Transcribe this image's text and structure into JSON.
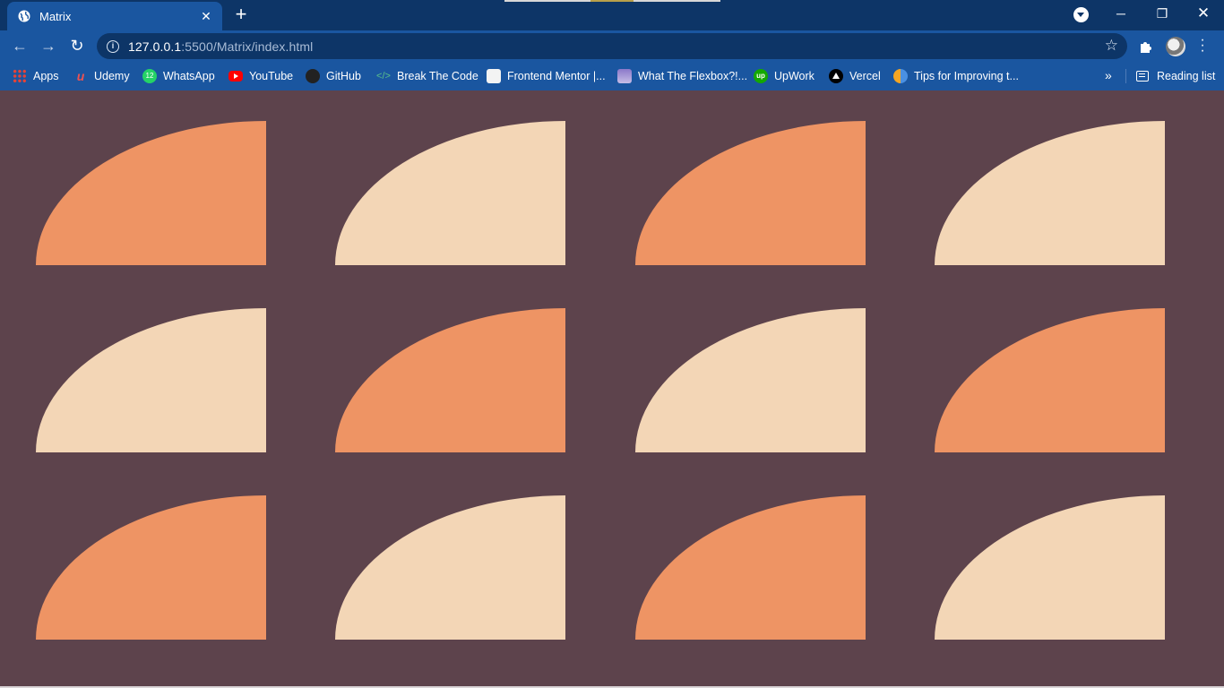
{
  "browser": {
    "tab_title": "Matrix",
    "new_tab_symbol": "+",
    "url_host": "127.0.0.1",
    "url_path": ":5500/Matrix/index.html",
    "bookmarks": [
      {
        "label": "Apps",
        "icon": "apps-grid-icon"
      },
      {
        "label": "Udemy",
        "icon": "udemy-icon"
      },
      {
        "label": "WhatsApp",
        "icon": "whatsapp-icon"
      },
      {
        "label": "YouTube",
        "icon": "youtube-icon"
      },
      {
        "label": "GitHub",
        "icon": "github-icon"
      },
      {
        "label": "Break The Code",
        "icon": "code-icon"
      },
      {
        "label": "Frontend Mentor |...",
        "icon": "frontend-mentor-icon"
      },
      {
        "label": "What The Flexbox?!...",
        "icon": "flexbox-icon"
      },
      {
        "label": "UpWork",
        "icon": "upwork-icon"
      },
      {
        "label": "Vercel",
        "icon": "vercel-icon"
      },
      {
        "label": "Tips for Improving t...",
        "icon": "tips-icon"
      }
    ],
    "more_bookmarks": "»",
    "reading_list": "Reading list"
  },
  "page": {
    "background": "#5d434c",
    "colors": {
      "orange": "#ee9464",
      "cream": "#f3d6b6"
    },
    "grid": {
      "rows": 3,
      "columns": 4,
      "tiles": [
        "orange",
        "cream",
        "orange",
        "cream",
        "cream",
        "orange",
        "cream",
        "orange",
        "orange",
        "cream",
        "orange",
        "cream"
      ]
    }
  }
}
